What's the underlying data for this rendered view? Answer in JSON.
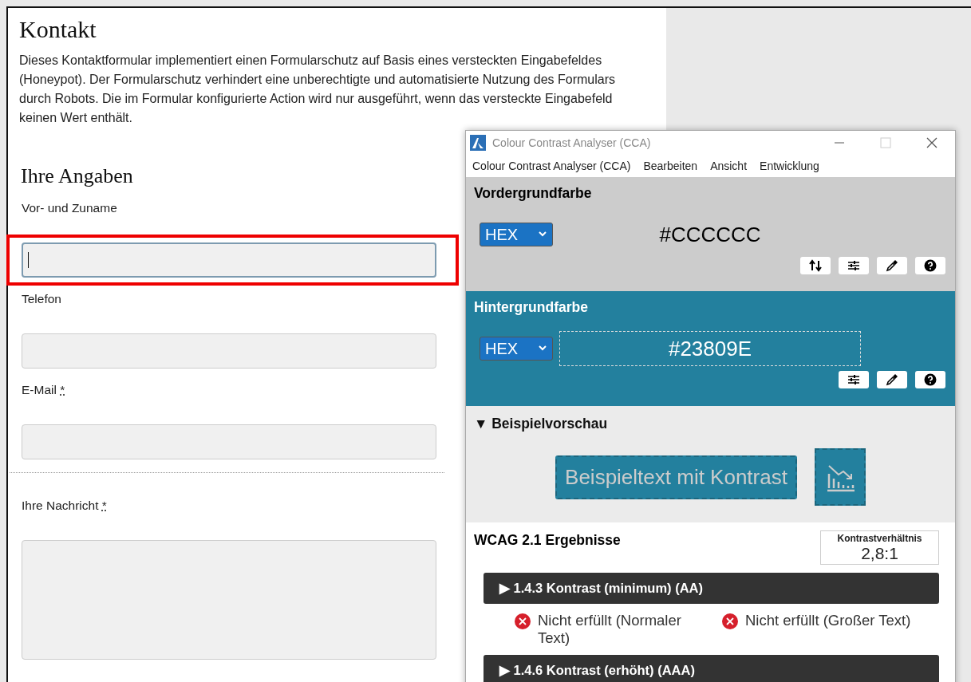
{
  "page": {
    "heading": "Kontakt",
    "intro": "Dieses Kontaktformular implementiert einen Formularschutz auf Basis eines versteckten Eingabefeldes (Honeypot). Der Formularschutz verhindert eine unberechtigte und automatisierte Nutzung des Formulars durch Robots. Die im Formular konfigurierte Action wird nur ausgeführt, wenn das versteckte Eingabefeld keinen Wert enthält.",
    "section_heading": "Ihre Angaben",
    "fields": [
      {
        "label": "Vor- und Zuname",
        "kind": "input",
        "focused": true,
        "highlighted": true
      },
      {
        "label": "Telefon",
        "kind": "input",
        "focused": false,
        "highlighted": false
      },
      {
        "label": "E-Mail",
        "required_mark": "*",
        "kind": "input",
        "focused": false,
        "highlighted": false
      },
      {
        "kind": "separator"
      },
      {
        "label": "Ihre Nachricht",
        "required_mark": "*",
        "kind": "textarea",
        "focused": false,
        "highlighted": false
      }
    ]
  },
  "cca": {
    "title": "Colour Contrast Analyser (CCA)",
    "menu": [
      "Colour Contrast Analyser (CCA)",
      "Bearbeiten",
      "Ansicht",
      "Entwicklung"
    ],
    "foreground": {
      "heading": "Vordergrundfarbe",
      "format": "HEX",
      "value": "#CCCCCC",
      "focused": false,
      "tools": [
        {
          "kind": "swap"
        },
        {
          "kind": "adjust"
        },
        {
          "kind": "picker"
        },
        {
          "kind": "help"
        }
      ]
    },
    "background": {
      "heading": "Hintergrundfarbe",
      "format": "HEX",
      "value": "#23809E",
      "focused": true,
      "tools": [
        {
          "kind": "adjust"
        },
        {
          "kind": "picker"
        },
        {
          "kind": "help"
        }
      ]
    },
    "preview": {
      "heading": "Beispielvorschau",
      "expanded": true,
      "toggle": "▼",
      "sample": "Beispieltext mit Kontrast"
    },
    "results": {
      "heading": "WCAG 2.1 Ergebnisse",
      "ratio_label": "Kontrastverhältnis",
      "ratio": "2,8:1",
      "criteria": [
        {
          "toggle": "▶",
          "title": "1.4.3 Kontrast (minimum) (AA)",
          "outcomes": [
            {
              "text": "Nicht erfüllt (Normaler Text)",
              "passed": false
            },
            {
              "text": "Nicht erfüllt (Großer Text)",
              "passed": false
            }
          ]
        },
        {
          "toggle": "▶",
          "title": "1.4.6 Kontrast (erhöht) (AAA)"
        }
      ]
    }
  }
}
